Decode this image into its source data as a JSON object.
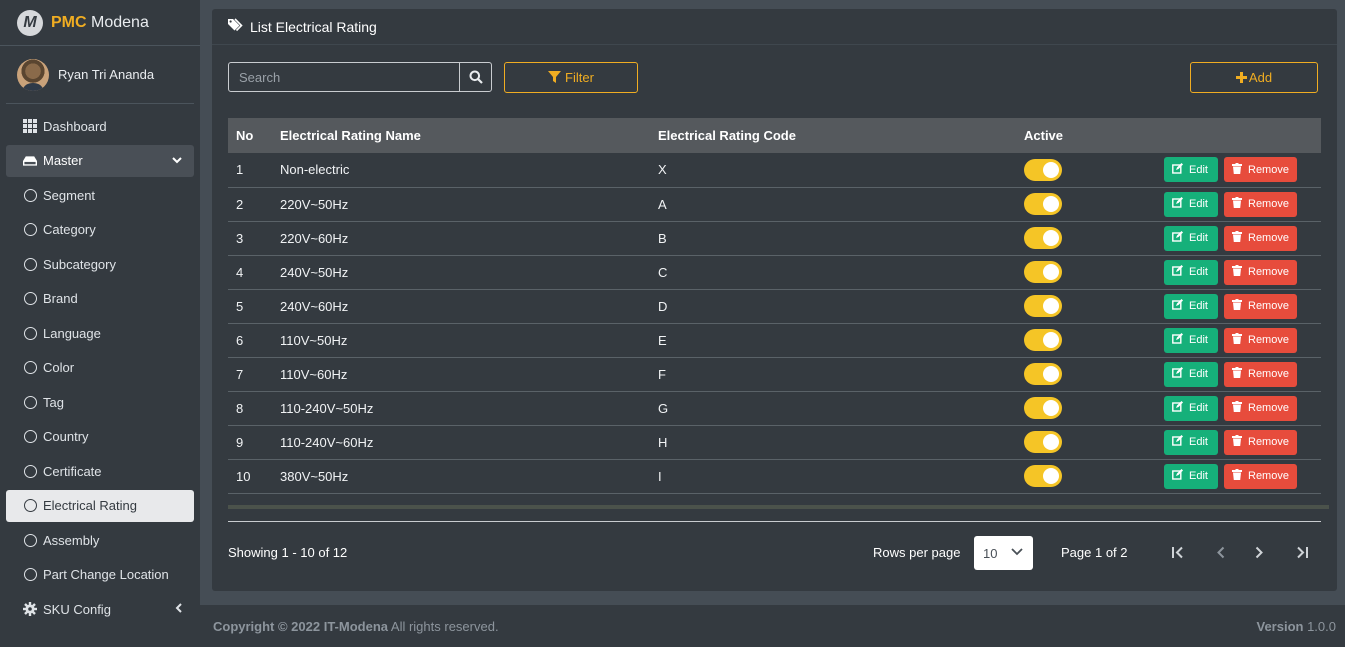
{
  "brand": {
    "logo_letter": "M",
    "name_bold": "PMC",
    "name_rest": "Modena"
  },
  "user": {
    "name": "Ryan Tri Ananda"
  },
  "sidebar": {
    "items": [
      {
        "label": "Dashboard",
        "icon": "grid-icon"
      },
      {
        "label": "Master",
        "icon": "drive-icon",
        "caret": "⌄"
      },
      {
        "label": "Segment"
      },
      {
        "label": "Category"
      },
      {
        "label": "Subcategory"
      },
      {
        "label": "Brand"
      },
      {
        "label": "Language"
      },
      {
        "label": "Color"
      },
      {
        "label": "Tag"
      },
      {
        "label": "Country"
      },
      {
        "label": "Certificate"
      },
      {
        "label": "Electrical Rating"
      },
      {
        "label": "Assembly"
      },
      {
        "label": "Part Change Location"
      },
      {
        "label": "SKU Config",
        "icon": "gear-icon",
        "caret": "‹"
      }
    ]
  },
  "page": {
    "title": "List Electrical Rating",
    "search_placeholder": "Search",
    "filter_label": "Filter",
    "add_label": "Add"
  },
  "table": {
    "headers": {
      "no": "No",
      "name": "Electrical Rating Name",
      "code": "Electrical Rating Code",
      "active": "Active"
    },
    "edit_label": "Edit",
    "remove_label": "Remove",
    "rows": [
      {
        "no": "1",
        "name": "Non-electric",
        "code": "X",
        "active": true
      },
      {
        "no": "2",
        "name": "220V~50Hz",
        "code": "A",
        "active": true
      },
      {
        "no": "3",
        "name": "220V~60Hz",
        "code": "B",
        "active": true
      },
      {
        "no": "4",
        "name": "240V~50Hz",
        "code": "C",
        "active": true
      },
      {
        "no": "5",
        "name": "240V~60Hz",
        "code": "D",
        "active": true
      },
      {
        "no": "6",
        "name": "110V~50Hz",
        "code": "E",
        "active": true
      },
      {
        "no": "7",
        "name": "110V~60Hz",
        "code": "F",
        "active": true
      },
      {
        "no": "8",
        "name": "110-240V~50Hz",
        "code": "G",
        "active": true
      },
      {
        "no": "9",
        "name": "110-240V~60Hz",
        "code": "H",
        "active": true
      },
      {
        "no": "10",
        "name": "380V~50Hz",
        "code": "I",
        "active": true
      }
    ]
  },
  "pagination": {
    "showing": "Showing 1 - 10 of 12",
    "rows_per_page_label": "Rows per page",
    "rows_per_page_value": "10",
    "page_info": "Page 1 of 2"
  },
  "footer": {
    "copyright": "Copyright © 2022 IT-Modena",
    "rights": "All rights reserved.",
    "version_label": "Version",
    "version_value": "1.0.0"
  },
  "colors": {
    "accent": "#f0ad22",
    "toggle_on": "#f5c526",
    "edit": "#16b07a",
    "remove": "#e74c3c",
    "sidebar_bg": "#343a40"
  }
}
